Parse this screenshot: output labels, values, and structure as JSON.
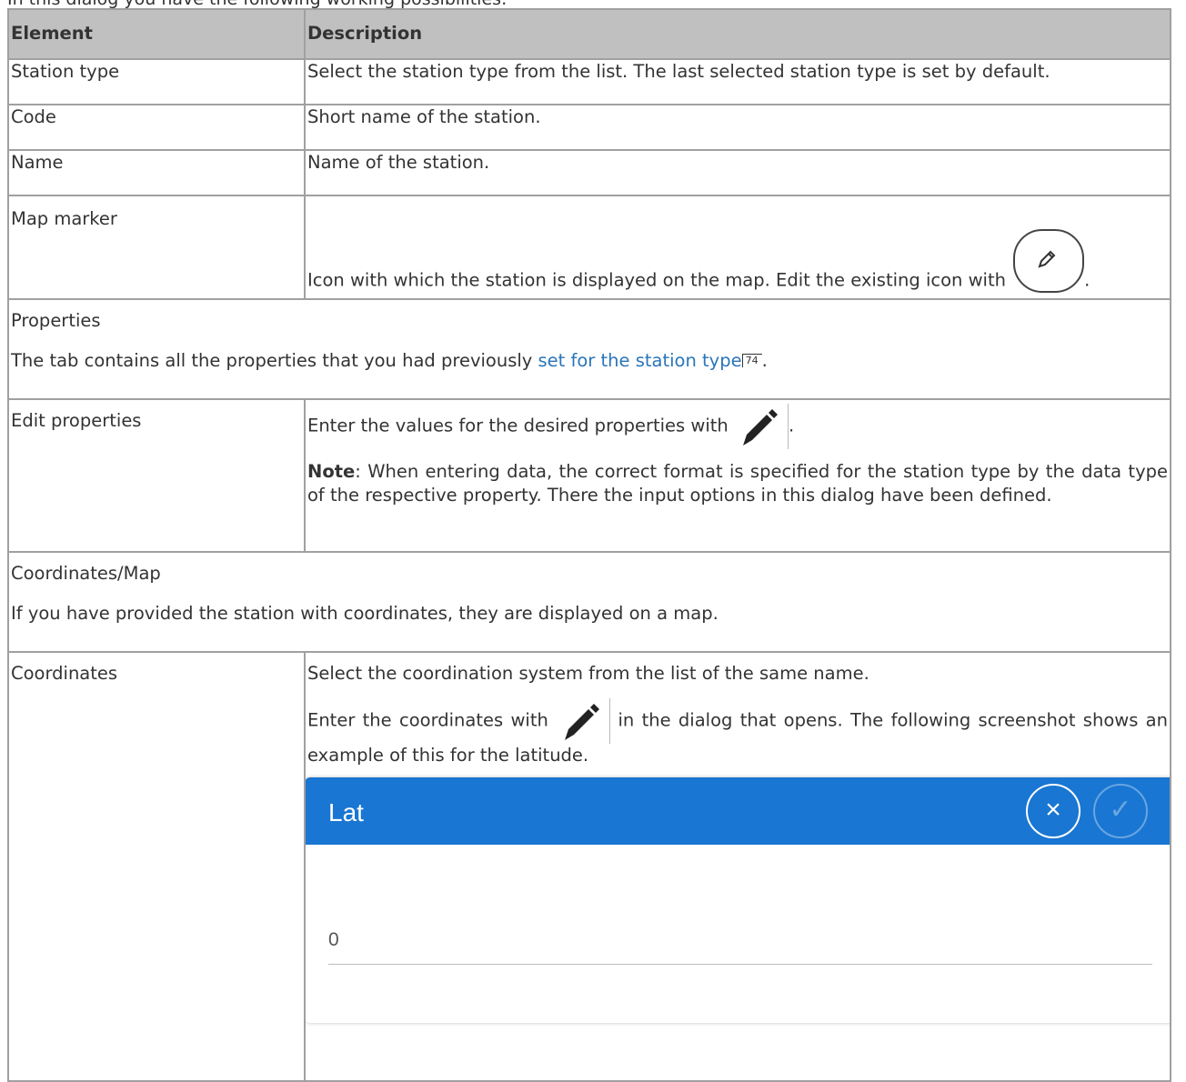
{
  "intro_text": "In this dialog you have the following working possibilities:",
  "table": {
    "header": {
      "element": "Element",
      "description": "Description"
    },
    "rows": [
      {
        "element": "Station type",
        "description": "Select the station type from the list. The last selected station type is set by default."
      },
      {
        "element": "Code",
        "description": "Short name of the station."
      },
      {
        "element": "Name",
        "description": "Name of the station."
      },
      {
        "element": "Map marker",
        "description": "Icon with which the station is displayed on the map. Edit the existing icon with"
      }
    ],
    "properties_section": {
      "title": "Properties",
      "text_before_link": "The tab contains all the properties that you had previously ",
      "link_text": "set for the station type",
      "ref_page": "74"
    },
    "edit_properties": {
      "element": "Edit properties",
      "text": "Enter the values for the desired properties with",
      "note_label": "Note",
      "note_text": ": When entering data, the correct format is specified for the station type by the data type of the respective property. There the input options in this dialog have been defined."
    },
    "coordinates_section": {
      "title": "Coordinates/Map",
      "text": "If you have provided the station with coordinates, they are displayed on a map."
    },
    "coordinates": {
      "element": "Coordinates",
      "text1": "Select the coordination system from the list of the same name.",
      "text2_before": "Enter the coordinates with",
      "text2_after": "in the dialog that opens. The following screenshot shows an example of this for the latitude."
    }
  },
  "dialog": {
    "title": "Lat",
    "value": "0",
    "close_glyph": "×",
    "confirm_glyph": "✓",
    "header_color": "#1976d2"
  },
  "icons": [
    "pencil-circle-icon",
    "pencil-icon"
  ],
  "link_color": "#2a75b8"
}
